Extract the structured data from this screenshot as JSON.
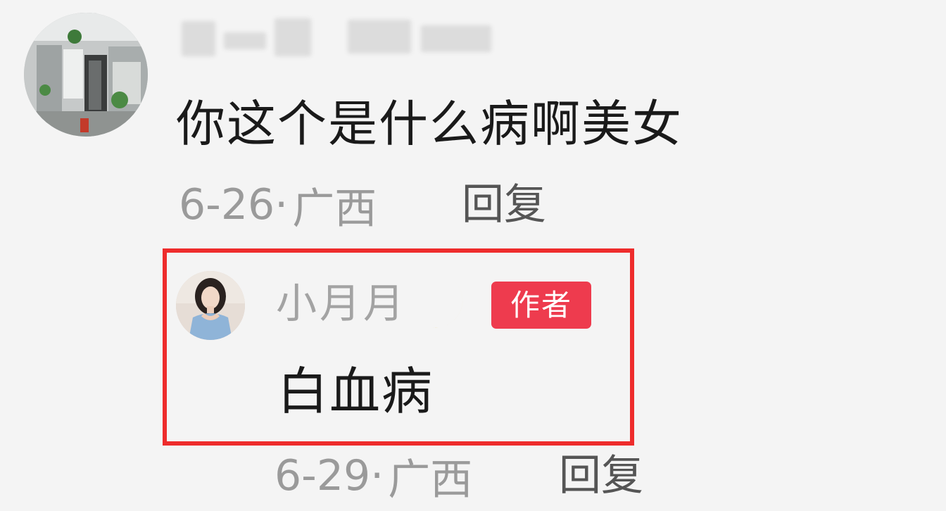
{
  "comment": {
    "text": "你这个是什么病啊美女",
    "date": "6-26",
    "separator": "·",
    "location": "广西",
    "reply_label": "回复",
    "avatar_icon": "user-avatar-room-photo",
    "username_blurred": true
  },
  "reply": {
    "author_name": "小月月",
    "name_icon": "crescent-moon-emoji",
    "badge_label": "作者",
    "badge_color": "#ee3b4e",
    "text": "白血病",
    "date": "6-29",
    "separator": "·",
    "location": "广西",
    "reply_label": "回复",
    "avatar_icon": "user-avatar-portrait",
    "highlight_color": "#ee2c2c"
  }
}
